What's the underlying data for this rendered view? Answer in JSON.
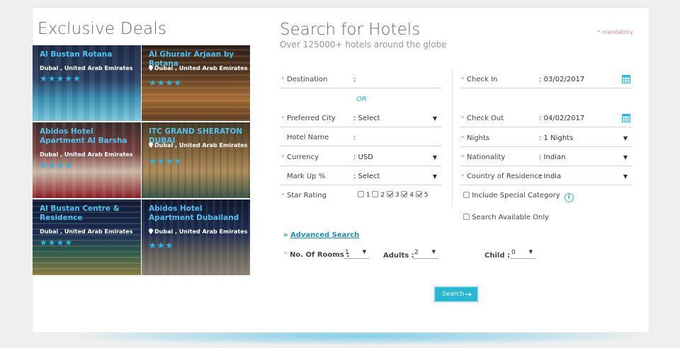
{
  "deals": {
    "title": "Exclusive Deals",
    "items": [
      {
        "name": "Al Bustan Rotana",
        "location": "Dubai , United Arab Emirates",
        "stars": "★★★★★",
        "pin": false
      },
      {
        "name": "Al Ghurair Arjaan by Rotana",
        "location": "Dubai , United Arab Emirates",
        "stars": "★★★★",
        "pin": true
      },
      {
        "name": "Abidos Hotel Apartment Al Barsha",
        "location": "Dubai , United Arab Emirates",
        "stars": "★★★★",
        "pin": false
      },
      {
        "name": "ITC GRAND SHERATON DUBAI",
        "location": "Dubai , United Arab Emirates",
        "stars": "★★★★",
        "pin": true
      },
      {
        "name": "Al Bustan Centre & Residence",
        "location": "Dubai , United Arab Emirates",
        "stars": "★★★★",
        "pin": false
      },
      {
        "name": "Abidos Hotel Apartment Dubailand",
        "location": "Dubai , United Arab Emirates",
        "stars": "★★★",
        "pin": true
      }
    ]
  },
  "form": {
    "title": "Search for Hotels",
    "subtitle": "Over 125000+ hotels around the globe",
    "mandatory": "mandatory",
    "or": "OR",
    "destination": {
      "label": "Destination",
      "value": ":"
    },
    "city": {
      "label": "Preferred City",
      "value": ": Select"
    },
    "hotel_name": {
      "label": "Hotel Name",
      "value": ":"
    },
    "currency": {
      "label": "Currency",
      "value": ": USD"
    },
    "markup": {
      "label": "Mark Up %",
      "value": ": Select"
    },
    "star_rating": {
      "label": "Star Rating",
      "options": [
        "1",
        "2",
        "3",
        "4",
        "5"
      ],
      "checked": [
        false,
        false,
        true,
        true,
        true
      ]
    },
    "check_in": {
      "label": "Check In",
      "value": ": 03/02/2017"
    },
    "check_out": {
      "label": "Check Out",
      "value": ": 04/02/2017"
    },
    "nights": {
      "label": "Nights",
      "value": ": 1 Nights"
    },
    "nationality": {
      "label": "Nationality",
      "value": ": Indian"
    },
    "residence": {
      "label": "Country of Residence",
      "value": ": India"
    },
    "special": {
      "label": "Include Special Category",
      "info": "i"
    },
    "available": {
      "label": "Search Available Only"
    },
    "advanced": {
      "prefix": "»",
      "label": "Advanced Search"
    },
    "rooms": {
      "label": "No. Of Rooms :",
      "value": "1"
    },
    "adults": {
      "label": "Adults :",
      "value": "2"
    },
    "child": {
      "label": "Child :",
      "value": "0"
    },
    "search_button": "Search",
    "arrow_glyph": "▼",
    "search_arrow": "→",
    "required_mark": "*"
  },
  "colors": {
    "accent": "#29b7e6",
    "deal_name": "#4fc3ef",
    "required": "#e58a8a"
  }
}
